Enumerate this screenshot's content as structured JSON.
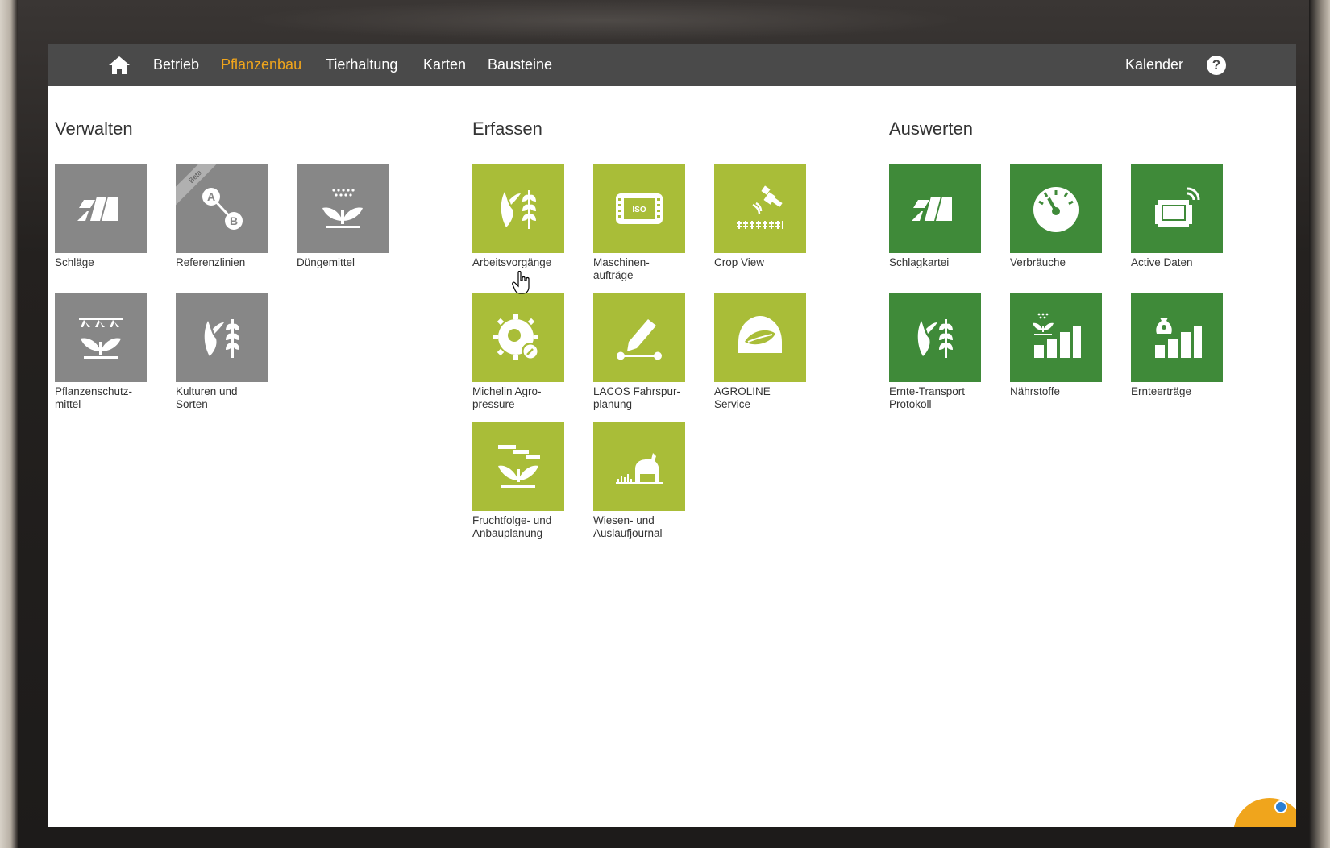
{
  "nav": {
    "items": [
      {
        "label": "Betrieb",
        "active": false
      },
      {
        "label": "Pflanzenbau",
        "active": true
      },
      {
        "label": "Tierhaltung",
        "active": false
      },
      {
        "label": "Karten",
        "active": false
      },
      {
        "label": "Bausteine",
        "active": false
      }
    ],
    "calendar_label": "Kalender",
    "help_label": "?"
  },
  "colors": {
    "navbar": "#4a4a4a",
    "active_nav": "#f0a51c",
    "tile_gray": "#878787",
    "tile_lime": "#a9bd38",
    "tile_green": "#3f8a39"
  },
  "sections": [
    {
      "title": "Verwalten",
      "tiles": [
        {
          "label": "Schläge",
          "icon": "field-stripes-icon"
        },
        {
          "label": "Referenzlinien",
          "icon": "ab-line-icon",
          "badge": "Beta"
        },
        {
          "label": "Düngemittel",
          "icon": "fertilizer-plant-icon"
        },
        {
          "label": "Pflanzenschutz-\nmittel",
          "icon": "plant-protection-icon"
        },
        {
          "label": "Kulturen und\nSorten",
          "icon": "corn-wheat-icon"
        }
      ]
    },
    {
      "title": "Erfassen",
      "tiles": [
        {
          "label": "Arbeitsvorgänge",
          "icon": "corn-wheat-icon"
        },
        {
          "label": "Maschinen-\naufträge",
          "icon": "iso-terminal-icon"
        },
        {
          "label": "Crop View",
          "icon": "satellite-crop-icon"
        },
        {
          "label": "Michelin Agro-\npressure",
          "icon": "tire-pressure-icon"
        },
        {
          "label": "LACOS Fahrspur-\nplanung",
          "icon": "pencil-track-icon"
        },
        {
          "label": "AGROLINE\nService",
          "icon": "agroline-leaf-icon"
        },
        {
          "label": "Fruchtfolge- und\nAnbauplanung",
          "icon": "crop-rotation-icon"
        },
        {
          "label": "Wiesen- und\nAuslaufjournal",
          "icon": "pasture-cow-icon"
        }
      ]
    },
    {
      "title": "Auswerten",
      "tiles": [
        {
          "label": "Schlagkartei",
          "icon": "field-stripes-icon"
        },
        {
          "label": "Verbräuche",
          "icon": "gauge-icon"
        },
        {
          "label": "Active Daten",
          "icon": "active-data-icon"
        },
        {
          "label": "Ernte-Transport\nProtokoll",
          "icon": "corn-wheat-icon"
        },
        {
          "label": "Nährstoffe",
          "icon": "nutrient-bars-icon"
        },
        {
          "label": "Ernteerträge",
          "icon": "yield-bars-icon"
        }
      ]
    }
  ]
}
